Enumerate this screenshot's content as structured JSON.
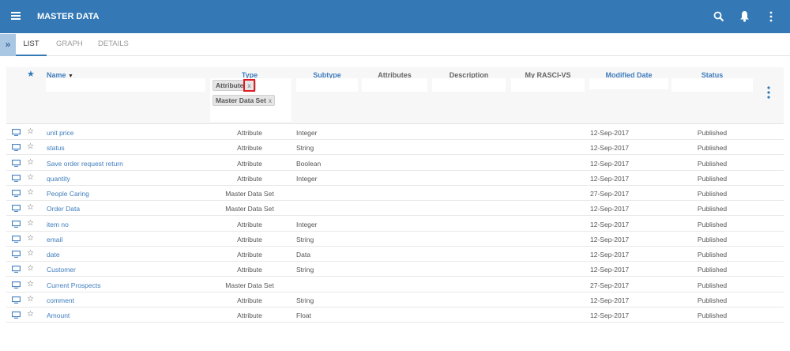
{
  "header": {
    "title": "MASTER DATA",
    "icons": [
      "menu-icon",
      "search-icon",
      "bell-icon",
      "more-vertical-icon"
    ]
  },
  "tabs": [
    {
      "label": "LIST",
      "active": true
    },
    {
      "label": "GRAPH"
    },
    {
      "label": "DETAILS"
    }
  ],
  "expander": "»",
  "columns": {
    "name": "Name",
    "type": "Type",
    "subtype": "Subtype",
    "attributes": "Attributes",
    "description": "Description",
    "rasci": "My RASCI-VS",
    "modified": "Modified Date",
    "status": "Status"
  },
  "type_filter_chips": [
    {
      "label": "Attribute",
      "remove": "x"
    },
    {
      "label": "Master Data Set",
      "remove": "x"
    }
  ],
  "highlight_color": "#e01b24",
  "rows": [
    {
      "name": "unit price",
      "type": "Attribute",
      "subtype": "Integer",
      "modified": "12-Sep-2017",
      "status": "Published"
    },
    {
      "name": "status",
      "type": "Attribute",
      "subtype": "String",
      "modified": "12-Sep-2017",
      "status": "Published"
    },
    {
      "name": "Save order request return",
      "type": "Attribute",
      "subtype": "Boolean",
      "modified": "12-Sep-2017",
      "status": "Published"
    },
    {
      "name": "quantity",
      "type": "Attribute",
      "subtype": "Integer",
      "modified": "12-Sep-2017",
      "status": "Published"
    },
    {
      "name": "People Caring",
      "type": "Master Data Set",
      "subtype": "",
      "modified": "27-Sep-2017",
      "status": "Published"
    },
    {
      "name": "Order Data",
      "type": "Master Data Set",
      "subtype": "",
      "modified": "12-Sep-2017",
      "status": "Published"
    },
    {
      "name": "item no",
      "type": "Attribute",
      "subtype": "Integer",
      "modified": "12-Sep-2017",
      "status": "Published"
    },
    {
      "name": "email",
      "type": "Attribute",
      "subtype": "String",
      "modified": "12-Sep-2017",
      "status": "Published"
    },
    {
      "name": "date",
      "type": "Attribute",
      "subtype": "Data",
      "modified": "12-Sep-2017",
      "status": "Published"
    },
    {
      "name": "Customer",
      "type": "Attribute",
      "subtype": "String",
      "modified": "12-Sep-2017",
      "status": "Published"
    },
    {
      "name": "Current Prospects",
      "type": "Master Data Set",
      "subtype": "",
      "modified": "27-Sep-2017",
      "status": "Published"
    },
    {
      "name": "comment",
      "type": "Attribute",
      "subtype": "String",
      "modified": "12-Sep-2017",
      "status": "Published"
    },
    {
      "name": "Amount",
      "type": "Attribute",
      "subtype": "Float",
      "modified": "12-Sep-2017",
      "status": "Published"
    }
  ]
}
